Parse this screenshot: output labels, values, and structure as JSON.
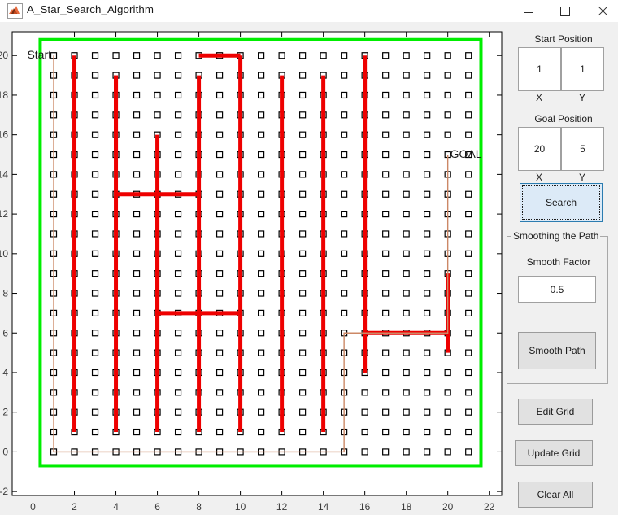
{
  "window": {
    "title": "A_Star_Search_Algorithm",
    "icon": "matlab-icon",
    "minimize_label": "–",
    "maximize_label": "□",
    "close_label": "✕"
  },
  "panel": {
    "start_group_label": "Start Position",
    "start_x_value": "1",
    "start_y_value": "1",
    "start_x_axis_label": "X",
    "start_y_axis_label": "Y",
    "goal_group_label": "Goal Position",
    "goal_x_value": "20",
    "goal_y_value": "5",
    "goal_x_axis_label": "X",
    "goal_y_axis_label": "Y",
    "search_button_label": "Search",
    "smoothing_group_label": "Smoothing the Path",
    "smooth_factor_label": "Smooth Factor",
    "smooth_factor_value": "0.5",
    "smooth_path_button_label": "Smooth Path",
    "edit_grid_button_label": "Edit Grid",
    "update_grid_button_label": "Update Grid",
    "clear_all_button_label": "Clear All"
  },
  "colors": {
    "boundary": "#00ee00",
    "obstacle_wall": "#ee0000",
    "path": "#cc8866",
    "node": "#000000",
    "axis": "#000000",
    "accent": "#2b7cb0"
  },
  "chart_data": {
    "type": "scatter",
    "title": "",
    "xlabel": "",
    "ylabel": "",
    "xlim": [
      -1,
      22.6
    ],
    "ylim": [
      -2.2,
      21.2
    ],
    "xticks": [
      0,
      2,
      4,
      6,
      8,
      10,
      12,
      14,
      16,
      18,
      20,
      22
    ],
    "xticklabels": [
      "0",
      "2",
      "4",
      "6",
      "8",
      "10",
      "12",
      "14",
      "16",
      "18",
      "20",
      "22"
    ],
    "yticks": [
      -2,
      0,
      2,
      4,
      6,
      8,
      10,
      12,
      14,
      16,
      18,
      20
    ],
    "yticklabels": [
      "-2",
      "0",
      "2",
      "4",
      "6",
      "8",
      "10",
      "12",
      "14",
      "16",
      "18",
      "20"
    ],
    "grid": false,
    "annotations": [
      {
        "text": "Start",
        "x": 1,
        "y": 20,
        "align": "right"
      },
      {
        "text": "GOAL",
        "x": 20,
        "y": 15,
        "align": "left"
      }
    ],
    "boundary_rect": {
      "x0": 0.35,
      "y0": -0.7,
      "x1": 21.6,
      "y1": 20.8
    },
    "grid_nodes": {
      "x_start": 1,
      "x_end": 21,
      "x_step": 1,
      "y_start": 0,
      "y_end": 20,
      "y_step": 1,
      "marker": "square",
      "marker_size": 7
    },
    "obstacle_walls": [
      {
        "x": 2,
        "y0": 1,
        "y1": 20
      },
      {
        "x": 4,
        "y0": 1,
        "y1": 19
      },
      {
        "x": 4,
        "y0": 15,
        "y1": 19
      },
      {
        "x": 6,
        "y0": 1,
        "y1": 16
      },
      {
        "x": 6,
        "y0": 4,
        "y1": 13
      },
      {
        "x": 8,
        "y0": 1,
        "y1": 19
      },
      {
        "x": 10,
        "y0": 1,
        "y1": 20
      },
      {
        "x": 12,
        "y0": 1,
        "y1": 19
      },
      {
        "x": 14,
        "y0": 1,
        "y1": 19
      },
      {
        "x": 16,
        "y0": 4,
        "y1": 20
      },
      {
        "x": 20,
        "y0": 5,
        "y1": 9
      }
    ],
    "path_polyline": [
      {
        "x": 1,
        "y": 20
      },
      {
        "x": 1,
        "y": 0
      },
      {
        "x": 15,
        "y": 0
      },
      {
        "x": 15,
        "y": 6
      },
      {
        "x": 20,
        "y": 6
      },
      {
        "x": 20,
        "y": 15
      }
    ]
  }
}
